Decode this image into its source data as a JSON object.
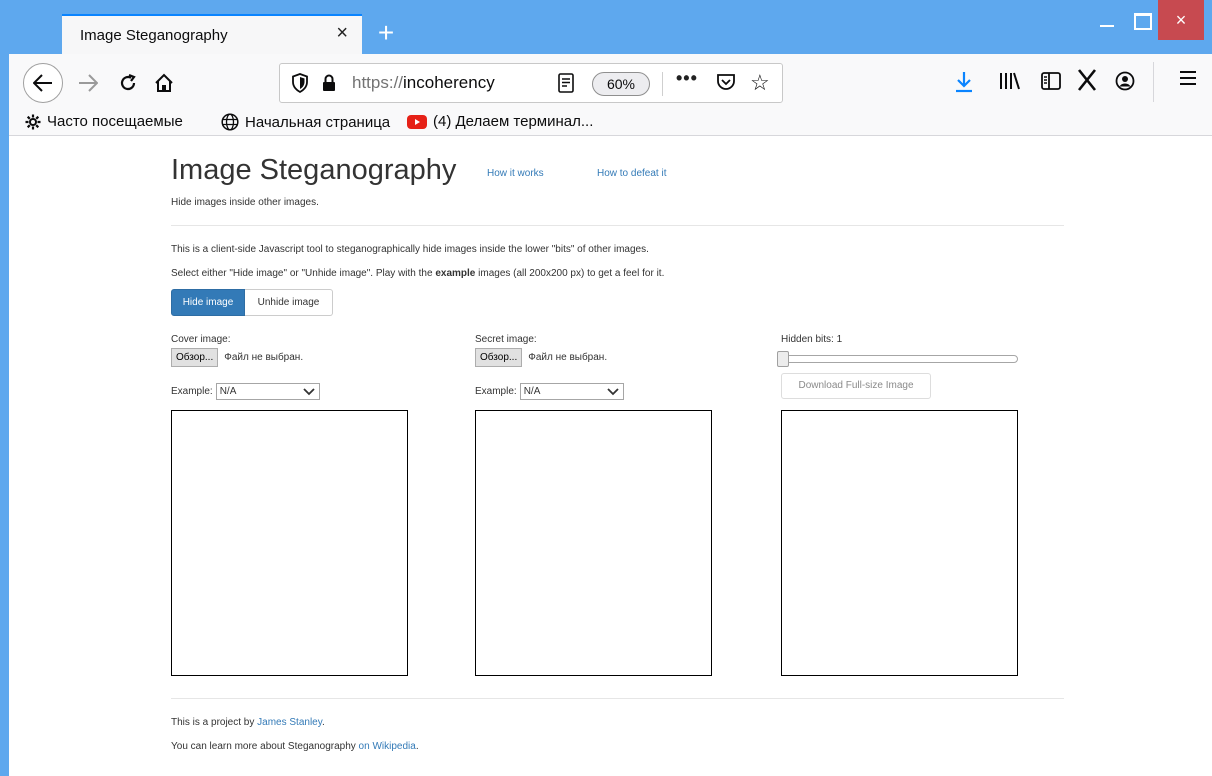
{
  "browser": {
    "tab_title": "Image Steganography",
    "tab_close": "×",
    "new_tab": "+",
    "window_close": "×",
    "url_scheme": "https://",
    "url_host": "incoherency",
    "zoom": "60%",
    "more": "•••",
    "star": "☆",
    "accent_color": "#5ea8ee"
  },
  "bookmarks": [
    {
      "label": "Часто посещаемые",
      "icon": "gear-icon"
    },
    {
      "label": "Начальная страница",
      "icon": "globe-icon"
    },
    {
      "label": "(4) Делаем терминал...",
      "icon": "youtube-icon"
    }
  ],
  "page": {
    "title": "Image Steganography",
    "nav_how_it_works": "How it works",
    "nav_how_to_defeat": "How to defeat it",
    "lead": "Hide images inside other images.",
    "intro": "This is a client-side Javascript tool to steganographically hide images inside the lower \"bits\" of other images.",
    "instructions_before": "Select either \"Hide image\" or \"Unhide image\". Play with the ",
    "instructions_bold": "example",
    "instructions_after": " images (all 200x200 px) to get a feel for it.",
    "btn_hide": "Hide image",
    "btn_unhide": "Unhide image",
    "cover_label": "Cover image:",
    "secret_label": "Secret image:",
    "hidden_bits_label": "Hidden bits: 1",
    "hidden_bits_value": 1,
    "file_button": "Обзор...",
    "file_status": "Файл не выбран.",
    "example_label": "Example:",
    "example_value": "N/A",
    "download_btn": "Download Full-size Image",
    "footer_text": "This is a project by ",
    "footer_link": "James Stanley",
    "footer_text2": "You can learn more about Steganography ",
    "footer_link2": "on Wikipedia",
    "footer_end": "."
  }
}
